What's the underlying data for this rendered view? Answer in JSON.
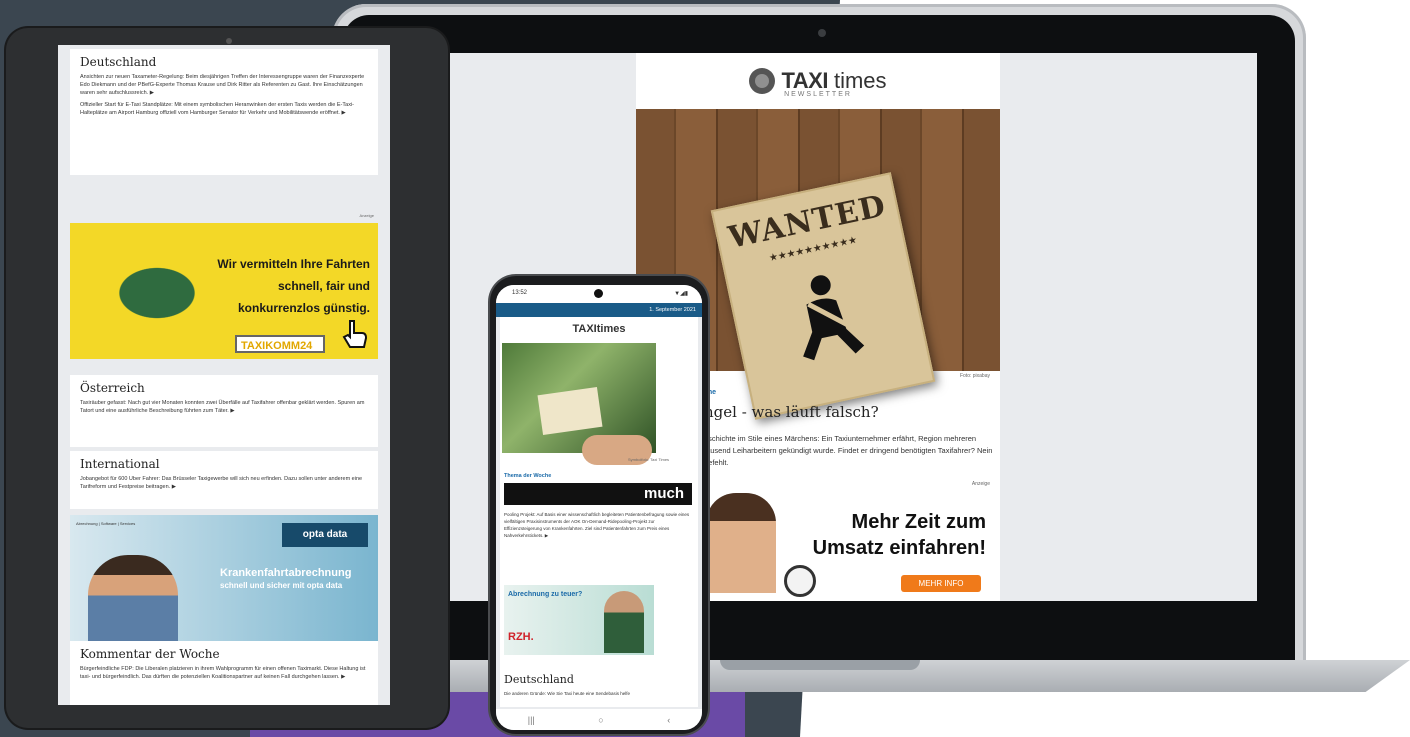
{
  "laptop": {
    "logo": {
      "brand": "TAXI",
      "brand2": "times",
      "sub": "NEWSLETTER"
    },
    "hero": {
      "poster_title": "WANTED",
      "poster_stars": "★★★★★★★★★★",
      "credit": "Foto: pixabay"
    },
    "topic_label": "che",
    "headline": "ngel - was läuft falsch?",
    "teaser": "eschichte im Stile eines Märchens: Ein Taxiunternehmer erfährt, Region mehreren tausend Leiharbeitern gekündigt wurde. Findet er dringend benötigten Taxifahrer? Nein gefehlt.",
    "ad_label": "Anzeige",
    "ad": {
      "text_line1": "Mehr Zeit zum",
      "text_line2": "Umsatz einfahren!",
      "button": "MEHR INFO"
    }
  },
  "tablet": {
    "sections": [
      {
        "title": "Deutschland",
        "paragraphs": [
          "Ansichten zur neuen Taxameter-Regelung: Beim diesjährigen Treffen der Interessengruppe waren der Finanzexperte Edo Diekmann und der PBefG-Experte Thomas Krause und Dirk Ritter als Referenten zu Gast. Ihre Einschätzungen waren sehr aufschlussreich. ▶",
          "Offizieller Start für E-Taxi Standplätze: Mit einem symbolischen Heranwinken der ersten Taxis werden die E-Taxi-Halteplätze am Airport Hamburg offiziell vom Hamburger Senator für Verkehr und Mobilitätswende eröffnet. ▶"
        ]
      },
      {
        "title": "Österreich",
        "paragraphs": [
          "Taxiräuber gefasst: Nach gut vier Monaten konnten zwei Überfälle auf Taxifahrer offenbar geklärt werden. Spuren am Tatort und eine ausführliche Beschreibung führten zum Täter. ▶"
        ]
      },
      {
        "title": "International",
        "paragraphs": [
          "Jobangebot für 600 Uber Fahrer: Das Brüsseler Taxigewerbe will sich neu erfinden. Dazu sollen unter anderem eine Tarifreform und Festpreise beitragen. ▶"
        ]
      },
      {
        "title": "Kommentar der Woche",
        "paragraphs": [
          "Bürgerfeindliche FDP: Die Liberalen platzieren in ihrem Wahlprogramm für einen offenen Taximarkt. Diese Haltung ist taxi- und bürgerfeindlich. Das dürften die potenziellen Koalitionspartner auf keinen Fall durchgehen lassen. ▶"
        ]
      }
    ],
    "ad_label": "Anzeige",
    "ad1": {
      "text1": "Wir vermitteln Ihre Fahrten",
      "text2": "schnell, fair und",
      "text3": "konkurrenzlos günstig.",
      "logo": "TAXIKOMM24"
    },
    "ad2": {
      "tabs": "Abrechnung | Software | Services",
      "logo": "opta data",
      "title": "Krankenfahrtabrechnung",
      "subtitle": "schnell und sicher mit opta data"
    }
  },
  "phone": {
    "status_time": "13:52",
    "status_icons": "▼◢▮",
    "date": "1. September 2021",
    "logo": "TAXItimes",
    "photo_credit": "Symbolfoto: Taxi Times",
    "topic_label": "Thema der Woche",
    "banner": "much",
    "text": "Pooling Projekt: Auf Basis einer wissenschaftlich begleiteten Patientenbefragung sowie eines vielfältigen Praxisinstruments der AOK On-Demand-Ridepooling-Projekt zur Effizienzsteigerung von Krankenfahrten. Ziel sind Patientenfahrten zum Preis eines Nahverkehrstickets. ▶",
    "ad": {
      "title": "Abrechnung zu teuer?",
      "logo": "RZH."
    },
    "section": "Deutschland",
    "section_text": "Die anderen Gründe: Wie Sie Taxi heute eine Sendebasis helfe",
    "nav": [
      "|||",
      "○",
      "‹"
    ]
  }
}
